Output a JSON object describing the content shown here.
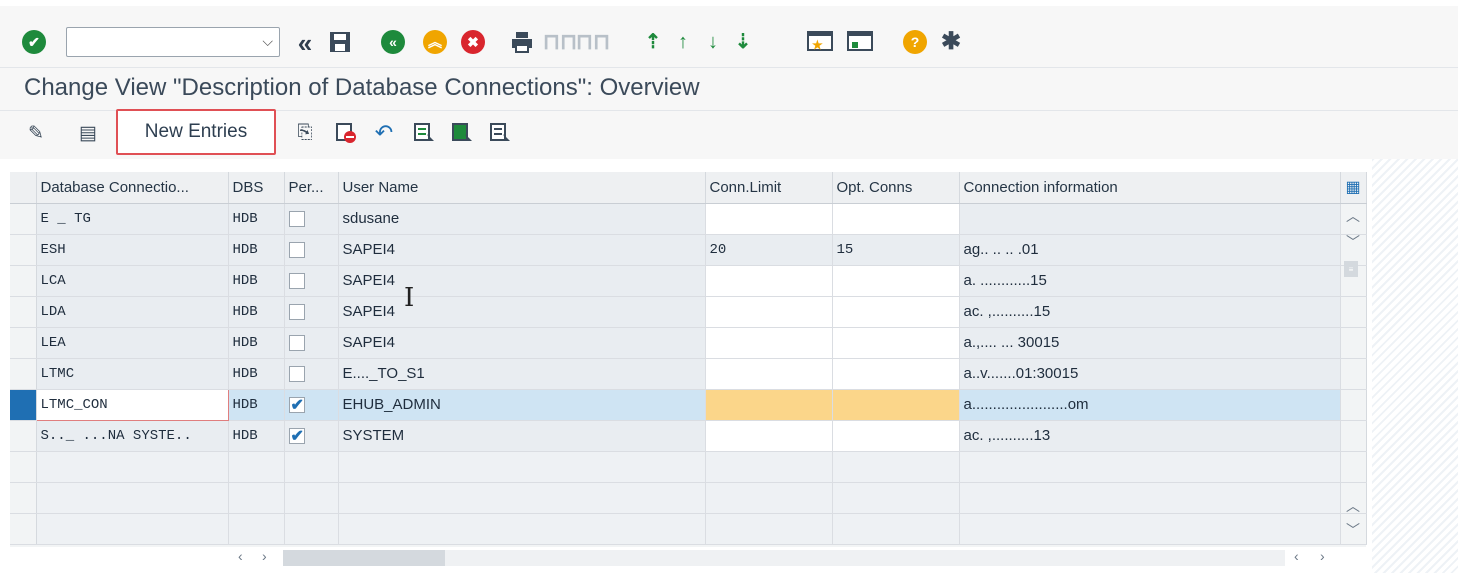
{
  "toolbar": {
    "command_field_value": "",
    "icons": [
      "enter-icon",
      "back-icon",
      "save-icon",
      "back-green-icon",
      "exit-icon",
      "cancel-icon",
      "print-icon",
      "find-icon",
      "find-next-icon",
      "first-page-icon",
      "previous-page-icon",
      "next-page-icon",
      "last-page-icon",
      "create-session-icon",
      "shortcut-icon",
      "help-icon",
      "settings-icon"
    ]
  },
  "page": {
    "title": "Change View \"Description of Database Connections\": Overview"
  },
  "app_toolbar": {
    "new_entries_label": "New Entries",
    "icons": [
      "display-change-icon",
      "details-icon",
      "copy-as-icon",
      "delete-icon",
      "undo-icon",
      "select-all-icon",
      "select-block-icon",
      "deselect-all-icon"
    ]
  },
  "table": {
    "columns": [
      "Database Connectio...",
      "DBS",
      "Per...",
      "User Name",
      "Conn.Limit",
      "Opt. Conns",
      "Connection information"
    ],
    "rows": [
      {
        "connection": "E      _ TG",
        "dbs": "HDB",
        "permanent": false,
        "user": "sdusane",
        "conn_limit": "",
        "opt_conns": "",
        "info": ""
      },
      {
        "connection": "ESH",
        "dbs": "HDB",
        "permanent": false,
        "user": "SAPEI4",
        "conn_limit": "20",
        "opt_conns": "15",
        "info": "ag.. ..  .. .01"
      },
      {
        "connection": "LCA",
        "dbs": "HDB",
        "permanent": false,
        "user": "SAPEI4",
        "conn_limit": "",
        "opt_conns": "",
        "info": "a. ............15"
      },
      {
        "connection": "LDA",
        "dbs": "HDB",
        "permanent": false,
        "user": "SAPEI4",
        "conn_limit": "",
        "opt_conns": "",
        "info": "ac. ,..........15"
      },
      {
        "connection": "LEA",
        "dbs": "HDB",
        "permanent": false,
        "user": "SAPEI4",
        "conn_limit": "",
        "opt_conns": "",
        "info": "a.,.... ... 30015"
      },
      {
        "connection": "LTMC",
        "dbs": "HDB",
        "permanent": false,
        "user": "E...._TO_S1",
        "conn_limit": "",
        "opt_conns": "",
        "info": "a..v.......01:30015"
      },
      {
        "connection": "LTMC_CON",
        "dbs": "HDB",
        "permanent": true,
        "user": "EHUB_ADMIN",
        "conn_limit": "",
        "opt_conns": "",
        "info": "a.......................om"
      },
      {
        "connection": "S.._ ...NA SYSTE..",
        "dbs": "HDB",
        "permanent": true,
        "user": "SYSTEM",
        "conn_limit": "",
        "opt_conns": "",
        "info": "ac. ,..........13"
      }
    ]
  },
  "colors": {
    "selected_row": "#cfe4f3",
    "selector_active": "#1f6fb3",
    "highlight_amber": "#fbd68a",
    "button_outline": "#e05055"
  }
}
